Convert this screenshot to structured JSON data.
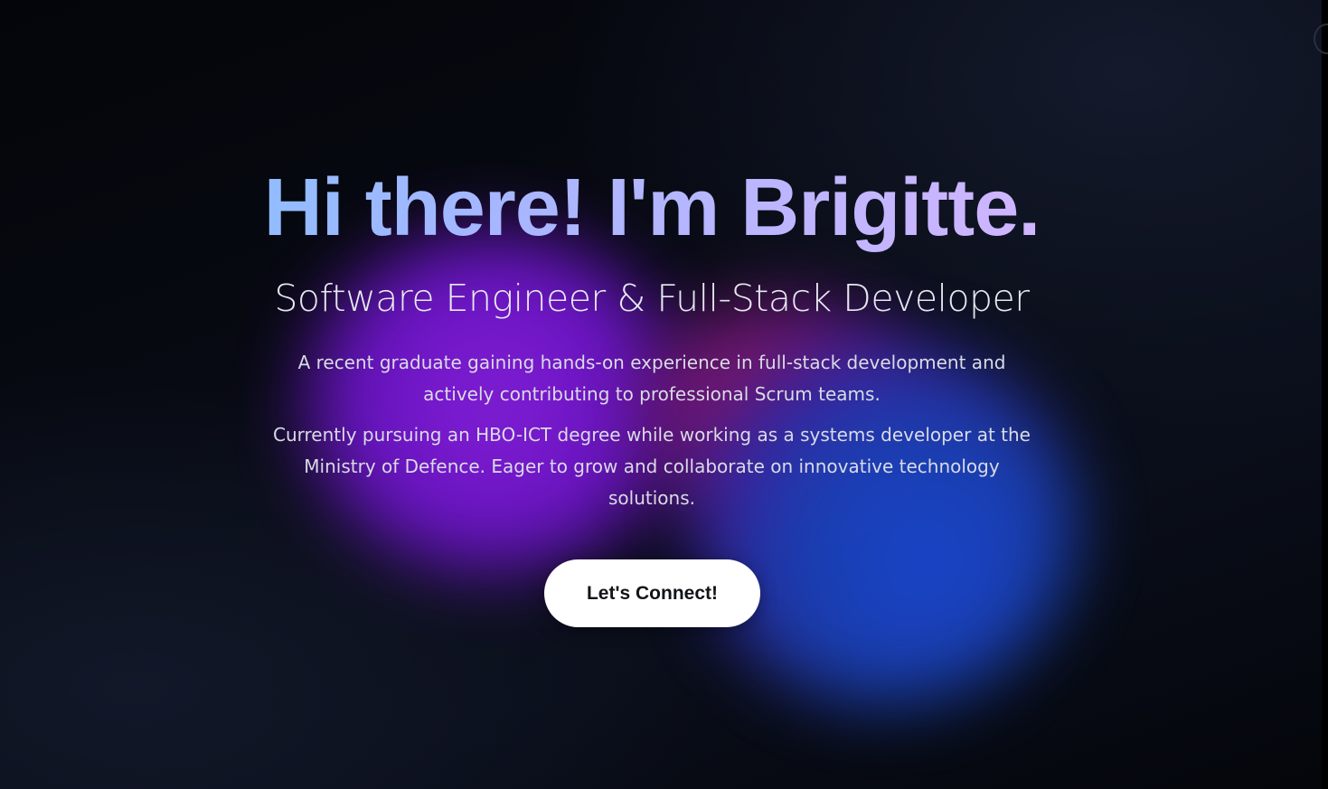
{
  "hero": {
    "title": "Hi there! I'm Brigitte.",
    "subtitle": "Software Engineer & Full-Stack Developer",
    "bio_paragraph_1": "A recent graduate gaining hands-on experience in full-stack development and actively contributing to professional Scrum teams.",
    "bio_paragraph_2": "Currently pursuing an HBO-ICT degree while working as a systems developer at the Ministry of Defence. Eager to grow and collaborate on innovative technology solutions.",
    "cta_label": "Let's Connect!"
  },
  "colors": {
    "background": "#05070d",
    "title_gradient_start": "#7cc2ff",
    "title_gradient_end": "#e2b6ff",
    "blob_purple": "#8a1fe0",
    "blob_blue": "#1a48d6",
    "cta_background": "#ffffff",
    "cta_text": "#111418"
  }
}
